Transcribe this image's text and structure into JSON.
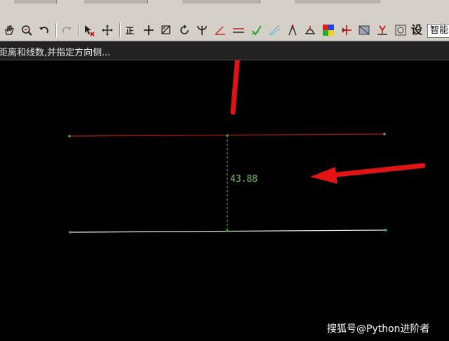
{
  "toolbar": {
    "tools": [
      "pan-hand-icon",
      "zoom-icon",
      "undo-icon",
      "redo-icon",
      "select-delete-icon",
      "move-icon",
      "orthogonal-icon",
      "cross-icon",
      "rotate-icon",
      "revolve-icon",
      "trident-icon",
      "angle-icon",
      "parallel-lines-icon",
      "green-check-icon",
      "dashed-curve-icon",
      "compass-icon",
      "profile-icon",
      "color-palette-icon",
      "extend-icon",
      "box-icon",
      "trim-icon",
      "settings-frame-icon"
    ],
    "set_label": "设",
    "mode_value": "智能"
  },
  "command_prompt": {
    "text": "距离和线数,并指定方向侧..."
  },
  "drawing": {
    "dimension_value": "43.88",
    "colors": {
      "top_line": "#a51c1c",
      "bottom_line": "#e6e6e6",
      "dimension": "#79c46a",
      "node": "#4caf3a",
      "arrow": "#e01414"
    }
  },
  "watermark": "搜狐号@Python进阶者"
}
